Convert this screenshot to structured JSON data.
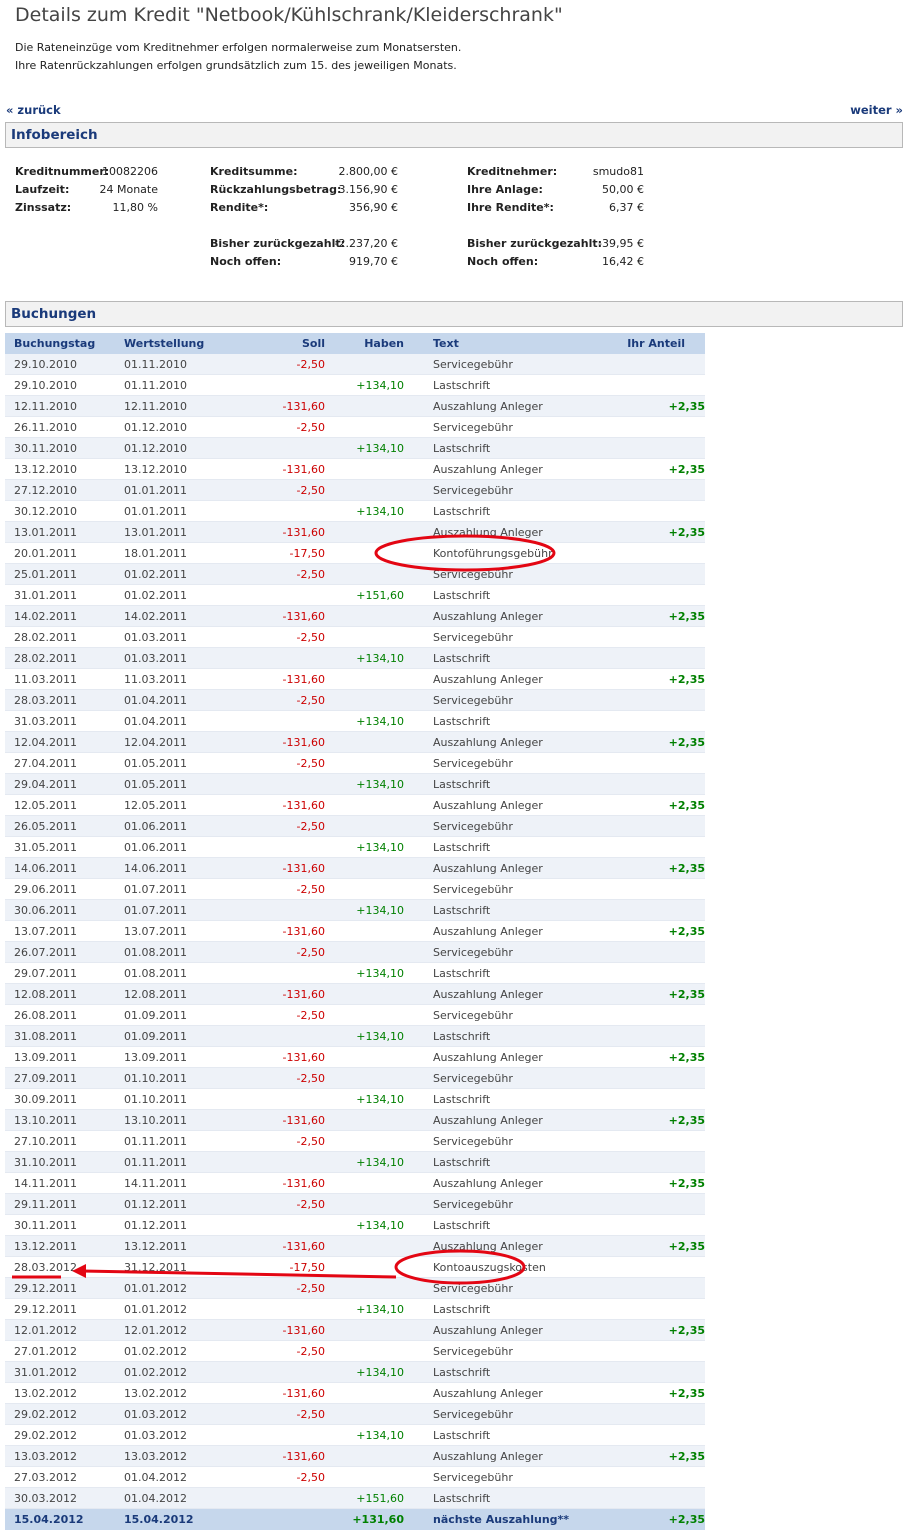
{
  "header": {
    "title": "Details zum Kredit \"Netbook/Kühlschrank/Kleiderschrank\"",
    "intro_line1": "Die Rateneinzüge vom Kreditnehmer erfolgen normalerweise zum Monatsersten.",
    "intro_line2": "Ihre Ratenrückzahlungen erfolgen grundsätzlich zum 15. des jeweiligen Monats."
  },
  "nav": {
    "back": "« zurück",
    "next": "weiter »"
  },
  "info": {
    "heading": "Infobereich",
    "kreditnummer_label": "Kreditnummer:",
    "kreditnummer": "10082206",
    "laufzeit_label": "Laufzeit:",
    "laufzeit": "24 Monate",
    "zinssatz_label": "Zinssatz:",
    "zinssatz": "11,80 %",
    "kreditsumme_label": "Kreditsumme:",
    "kreditsumme": "2.800,00 €",
    "rueckzahlung_label": "Rückzahlungsbetrag:",
    "rueckzahlung": "3.156,90 €",
    "rendite_label": "Rendite*:",
    "rendite": "356,90 €",
    "bisher_label": "Bisher zurückgezahlt:",
    "bisher": "-2.237,20 €",
    "offen_label": "Noch offen:",
    "offen": "919,70 €",
    "kreditnehmer_label": "Kreditnehmer:",
    "kreditnehmer": "smudo81",
    "anlage_label": "Ihre Anlage:",
    "anlage": "50,00 €",
    "ihre_rendite_label": "Ihre Rendite*:",
    "ihre_rendite": "6,37 €",
    "ihr_bisher_label": "Bisher zurückgezahlt:",
    "ihr_bisher": "-39,95 €",
    "ihr_offen_label": "Noch offen:",
    "ihr_offen": "16,42 €"
  },
  "bookings": {
    "heading": "Buchungen",
    "columns": [
      "Buchungstag",
      "Wertstellung",
      "Soll",
      "Haben",
      "Text",
      "Ihr Anteil"
    ],
    "rows": [
      [
        "29.10.2010",
        "01.11.2010",
        "-2,50",
        "",
        "Servicegebühr",
        ""
      ],
      [
        "29.10.2010",
        "01.11.2010",
        "",
        "+134,10",
        "Lastschrift",
        ""
      ],
      [
        "12.11.2010",
        "12.11.2010",
        "-131,60",
        "",
        "Auszahlung Anleger",
        "+2,35"
      ],
      [
        "26.11.2010",
        "01.12.2010",
        "-2,50",
        "",
        "Servicegebühr",
        ""
      ],
      [
        "30.11.2010",
        "01.12.2010",
        "",
        "+134,10",
        "Lastschrift",
        ""
      ],
      [
        "13.12.2010",
        "13.12.2010",
        "-131,60",
        "",
        "Auszahlung Anleger",
        "+2,35"
      ],
      [
        "27.12.2010",
        "01.01.2011",
        "-2,50",
        "",
        "Servicegebühr",
        ""
      ],
      [
        "30.12.2010",
        "01.01.2011",
        "",
        "+134,10",
        "Lastschrift",
        ""
      ],
      [
        "13.01.2011",
        "13.01.2011",
        "-131,60",
        "",
        "Auszahlung Anleger",
        "+2,35"
      ],
      [
        "20.01.2011",
        "18.01.2011",
        "-17,50",
        "",
        "Kontoführungsgebühr",
        ""
      ],
      [
        "25.01.2011",
        "01.02.2011",
        "-2,50",
        "",
        "Servicegebühr",
        ""
      ],
      [
        "31.01.2011",
        "01.02.2011",
        "",
        "+151,60",
        "Lastschrift",
        ""
      ],
      [
        "14.02.2011",
        "14.02.2011",
        "-131,60",
        "",
        "Auszahlung Anleger",
        "+2,35"
      ],
      [
        "28.02.2011",
        "01.03.2011",
        "-2,50",
        "",
        "Servicegebühr",
        ""
      ],
      [
        "28.02.2011",
        "01.03.2011",
        "",
        "+134,10",
        "Lastschrift",
        ""
      ],
      [
        "11.03.2011",
        "11.03.2011",
        "-131,60",
        "",
        "Auszahlung Anleger",
        "+2,35"
      ],
      [
        "28.03.2011",
        "01.04.2011",
        "-2,50",
        "",
        "Servicegebühr",
        ""
      ],
      [
        "31.03.2011",
        "01.04.2011",
        "",
        "+134,10",
        "Lastschrift",
        ""
      ],
      [
        "12.04.2011",
        "12.04.2011",
        "-131,60",
        "",
        "Auszahlung Anleger",
        "+2,35"
      ],
      [
        "27.04.2011",
        "01.05.2011",
        "-2,50",
        "",
        "Servicegebühr",
        ""
      ],
      [
        "29.04.2011",
        "01.05.2011",
        "",
        "+134,10",
        "Lastschrift",
        ""
      ],
      [
        "12.05.2011",
        "12.05.2011",
        "-131,60",
        "",
        "Auszahlung Anleger",
        "+2,35"
      ],
      [
        "26.05.2011",
        "01.06.2011",
        "-2,50",
        "",
        "Servicegebühr",
        ""
      ],
      [
        "31.05.2011",
        "01.06.2011",
        "",
        "+134,10",
        "Lastschrift",
        ""
      ],
      [
        "14.06.2011",
        "14.06.2011",
        "-131,60",
        "",
        "Auszahlung Anleger",
        "+2,35"
      ],
      [
        "29.06.2011",
        "01.07.2011",
        "-2,50",
        "",
        "Servicegebühr",
        ""
      ],
      [
        "30.06.2011",
        "01.07.2011",
        "",
        "+134,10",
        "Lastschrift",
        ""
      ],
      [
        "13.07.2011",
        "13.07.2011",
        "-131,60",
        "",
        "Auszahlung Anleger",
        "+2,35"
      ],
      [
        "26.07.2011",
        "01.08.2011",
        "-2,50",
        "",
        "Servicegebühr",
        ""
      ],
      [
        "29.07.2011",
        "01.08.2011",
        "",
        "+134,10",
        "Lastschrift",
        ""
      ],
      [
        "12.08.2011",
        "12.08.2011",
        "-131,60",
        "",
        "Auszahlung Anleger",
        "+2,35"
      ],
      [
        "26.08.2011",
        "01.09.2011",
        "-2,50",
        "",
        "Servicegebühr",
        ""
      ],
      [
        "31.08.2011",
        "01.09.2011",
        "",
        "+134,10",
        "Lastschrift",
        ""
      ],
      [
        "13.09.2011",
        "13.09.2011",
        "-131,60",
        "",
        "Auszahlung Anleger",
        "+2,35"
      ],
      [
        "27.09.2011",
        "01.10.2011",
        "-2,50",
        "",
        "Servicegebühr",
        ""
      ],
      [
        "30.09.2011",
        "01.10.2011",
        "",
        "+134,10",
        "Lastschrift",
        ""
      ],
      [
        "13.10.2011",
        "13.10.2011",
        "-131,60",
        "",
        "Auszahlung Anleger",
        "+2,35"
      ],
      [
        "27.10.2011",
        "01.11.2011",
        "-2,50",
        "",
        "Servicegebühr",
        ""
      ],
      [
        "31.10.2011",
        "01.11.2011",
        "",
        "+134,10",
        "Lastschrift",
        ""
      ],
      [
        "14.11.2011",
        "14.11.2011",
        "-131,60",
        "",
        "Auszahlung Anleger",
        "+2,35"
      ],
      [
        "29.11.2011",
        "01.12.2011",
        "-2,50",
        "",
        "Servicegebühr",
        ""
      ],
      [
        "30.11.2011",
        "01.12.2011",
        "",
        "+134,10",
        "Lastschrift",
        ""
      ],
      [
        "13.12.2011",
        "13.12.2011",
        "-131,60",
        "",
        "Auszahlung Anleger",
        "+2,35"
      ],
      [
        "28.03.2012",
        "31.12.2011",
        "-17,50",
        "",
        "Kontoauszugskosten",
        ""
      ],
      [
        "29.12.2011",
        "01.01.2012",
        "-2,50",
        "",
        "Servicegebühr",
        ""
      ],
      [
        "29.12.2011",
        "01.01.2012",
        "",
        "+134,10",
        "Lastschrift",
        ""
      ],
      [
        "12.01.2012",
        "12.01.2012",
        "-131,60",
        "",
        "Auszahlung Anleger",
        "+2,35"
      ],
      [
        "27.01.2012",
        "01.02.2012",
        "-2,50",
        "",
        "Servicegebühr",
        ""
      ],
      [
        "31.01.2012",
        "01.02.2012",
        "",
        "+134,10",
        "Lastschrift",
        ""
      ],
      [
        "13.02.2012",
        "13.02.2012",
        "-131,60",
        "",
        "Auszahlung Anleger",
        "+2,35"
      ],
      [
        "29.02.2012",
        "01.03.2012",
        "-2,50",
        "",
        "Servicegebühr",
        ""
      ],
      [
        "29.02.2012",
        "01.03.2012",
        "",
        "+134,10",
        "Lastschrift",
        ""
      ],
      [
        "13.03.2012",
        "13.03.2012",
        "-131,60",
        "",
        "Auszahlung Anleger",
        "+2,35"
      ],
      [
        "27.03.2012",
        "01.04.2012",
        "-2,50",
        "",
        "Servicegebühr",
        ""
      ],
      [
        "30.03.2012",
        "01.04.2012",
        "",
        "+151,60",
        "Lastschrift",
        ""
      ]
    ],
    "footer": [
      "15.04.2012",
      "15.04.2012",
      "",
      "+131,60",
      "nächste Auszahlung**",
      "+2,35"
    ]
  },
  "annotation_colors": {
    "marker": "#e30613"
  }
}
